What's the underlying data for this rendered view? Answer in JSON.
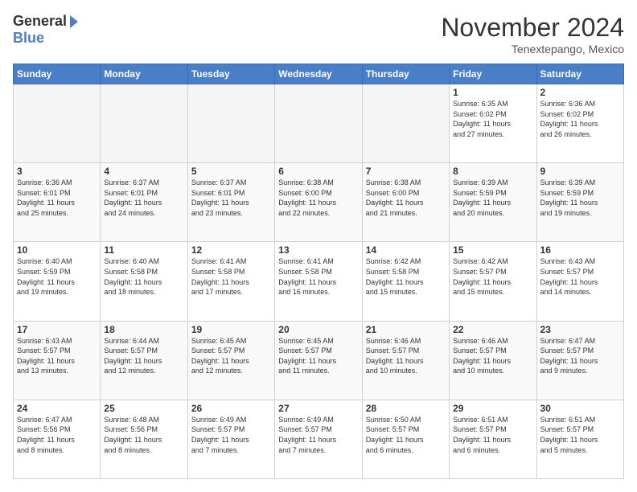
{
  "logo": {
    "general": "General",
    "blue": "Blue"
  },
  "header": {
    "month": "November 2024",
    "location": "Tenextepango, Mexico"
  },
  "weekdays": [
    "Sunday",
    "Monday",
    "Tuesday",
    "Wednesday",
    "Thursday",
    "Friday",
    "Saturday"
  ],
  "weeks": [
    [
      {
        "day": "",
        "info": ""
      },
      {
        "day": "",
        "info": ""
      },
      {
        "day": "",
        "info": ""
      },
      {
        "day": "",
        "info": ""
      },
      {
        "day": "",
        "info": ""
      },
      {
        "day": "1",
        "info": "Sunrise: 6:35 AM\nSunset: 6:02 PM\nDaylight: 11 hours\nand 27 minutes."
      },
      {
        "day": "2",
        "info": "Sunrise: 6:36 AM\nSunset: 6:02 PM\nDaylight: 11 hours\nand 26 minutes."
      }
    ],
    [
      {
        "day": "3",
        "info": "Sunrise: 6:36 AM\nSunset: 6:01 PM\nDaylight: 11 hours\nand 25 minutes."
      },
      {
        "day": "4",
        "info": "Sunrise: 6:37 AM\nSunset: 6:01 PM\nDaylight: 11 hours\nand 24 minutes."
      },
      {
        "day": "5",
        "info": "Sunrise: 6:37 AM\nSunset: 6:01 PM\nDaylight: 11 hours\nand 23 minutes."
      },
      {
        "day": "6",
        "info": "Sunrise: 6:38 AM\nSunset: 6:00 PM\nDaylight: 11 hours\nand 22 minutes."
      },
      {
        "day": "7",
        "info": "Sunrise: 6:38 AM\nSunset: 6:00 PM\nDaylight: 11 hours\nand 21 minutes."
      },
      {
        "day": "8",
        "info": "Sunrise: 6:39 AM\nSunset: 5:59 PM\nDaylight: 11 hours\nand 20 minutes."
      },
      {
        "day": "9",
        "info": "Sunrise: 6:39 AM\nSunset: 5:59 PM\nDaylight: 11 hours\nand 19 minutes."
      }
    ],
    [
      {
        "day": "10",
        "info": "Sunrise: 6:40 AM\nSunset: 5:59 PM\nDaylight: 11 hours\nand 19 minutes."
      },
      {
        "day": "11",
        "info": "Sunrise: 6:40 AM\nSunset: 5:58 PM\nDaylight: 11 hours\nand 18 minutes."
      },
      {
        "day": "12",
        "info": "Sunrise: 6:41 AM\nSunset: 5:58 PM\nDaylight: 11 hours\nand 17 minutes."
      },
      {
        "day": "13",
        "info": "Sunrise: 6:41 AM\nSunset: 5:58 PM\nDaylight: 11 hours\nand 16 minutes."
      },
      {
        "day": "14",
        "info": "Sunrise: 6:42 AM\nSunset: 5:58 PM\nDaylight: 11 hours\nand 15 minutes."
      },
      {
        "day": "15",
        "info": "Sunrise: 6:42 AM\nSunset: 5:57 PM\nDaylight: 11 hours\nand 15 minutes."
      },
      {
        "day": "16",
        "info": "Sunrise: 6:43 AM\nSunset: 5:57 PM\nDaylight: 11 hours\nand 14 minutes."
      }
    ],
    [
      {
        "day": "17",
        "info": "Sunrise: 6:43 AM\nSunset: 5:57 PM\nDaylight: 11 hours\nand 13 minutes."
      },
      {
        "day": "18",
        "info": "Sunrise: 6:44 AM\nSunset: 5:57 PM\nDaylight: 11 hours\nand 12 minutes."
      },
      {
        "day": "19",
        "info": "Sunrise: 6:45 AM\nSunset: 5:57 PM\nDaylight: 11 hours\nand 12 minutes."
      },
      {
        "day": "20",
        "info": "Sunrise: 6:45 AM\nSunset: 5:57 PM\nDaylight: 11 hours\nand 11 minutes."
      },
      {
        "day": "21",
        "info": "Sunrise: 6:46 AM\nSunset: 5:57 PM\nDaylight: 11 hours\nand 10 minutes."
      },
      {
        "day": "22",
        "info": "Sunrise: 6:46 AM\nSunset: 5:57 PM\nDaylight: 11 hours\nand 10 minutes."
      },
      {
        "day": "23",
        "info": "Sunrise: 6:47 AM\nSunset: 5:57 PM\nDaylight: 11 hours\nand 9 minutes."
      }
    ],
    [
      {
        "day": "24",
        "info": "Sunrise: 6:47 AM\nSunset: 5:56 PM\nDaylight: 11 hours\nand 8 minutes."
      },
      {
        "day": "25",
        "info": "Sunrise: 6:48 AM\nSunset: 5:56 PM\nDaylight: 11 hours\nand 8 minutes."
      },
      {
        "day": "26",
        "info": "Sunrise: 6:49 AM\nSunset: 5:57 PM\nDaylight: 11 hours\nand 7 minutes."
      },
      {
        "day": "27",
        "info": "Sunrise: 6:49 AM\nSunset: 5:57 PM\nDaylight: 11 hours\nand 7 minutes."
      },
      {
        "day": "28",
        "info": "Sunrise: 6:50 AM\nSunset: 5:57 PM\nDaylight: 11 hours\nand 6 minutes."
      },
      {
        "day": "29",
        "info": "Sunrise: 6:51 AM\nSunset: 5:57 PM\nDaylight: 11 hours\nand 6 minutes."
      },
      {
        "day": "30",
        "info": "Sunrise: 6:51 AM\nSunset: 5:57 PM\nDaylight: 11 hours\nand 5 minutes."
      }
    ]
  ]
}
